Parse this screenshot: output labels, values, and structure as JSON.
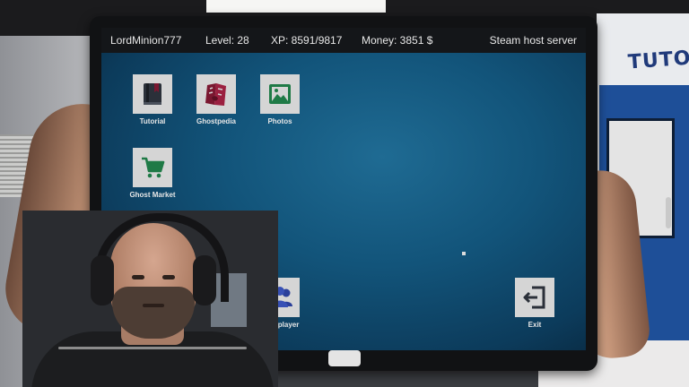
{
  "statusbar": {
    "player_name": "LordMinion777",
    "level": "Level: 28",
    "xp": "XP: 8591/9817",
    "money": "Money: 3851 $",
    "server": "Steam host server"
  },
  "apps": {
    "tutorial": {
      "label": "Tutorial",
      "icon": "book-icon"
    },
    "ghostpedia": {
      "label": "Ghostpedia",
      "icon": "ghostpedia-icon"
    },
    "photos": {
      "label": "Photos",
      "icon": "image-icon"
    },
    "ghost_market": {
      "label": "Ghost Market",
      "icon": "cart-icon"
    },
    "multiplayer": {
      "label": "multiplayer",
      "icon": "users-icon"
    },
    "exit": {
      "label": "Exit",
      "icon": "exit-icon"
    }
  },
  "colors": {
    "tile_bg": "#d5d5d5",
    "icon_dark": "#2b3039",
    "icon_red": "#7a1730",
    "icon_green": "#1f7a46",
    "icon_blue": "#2a3f9a",
    "statusbar_bg": "#141619",
    "sign_blue": "#203a7a"
  },
  "background": {
    "sign_text": "TUTO"
  }
}
